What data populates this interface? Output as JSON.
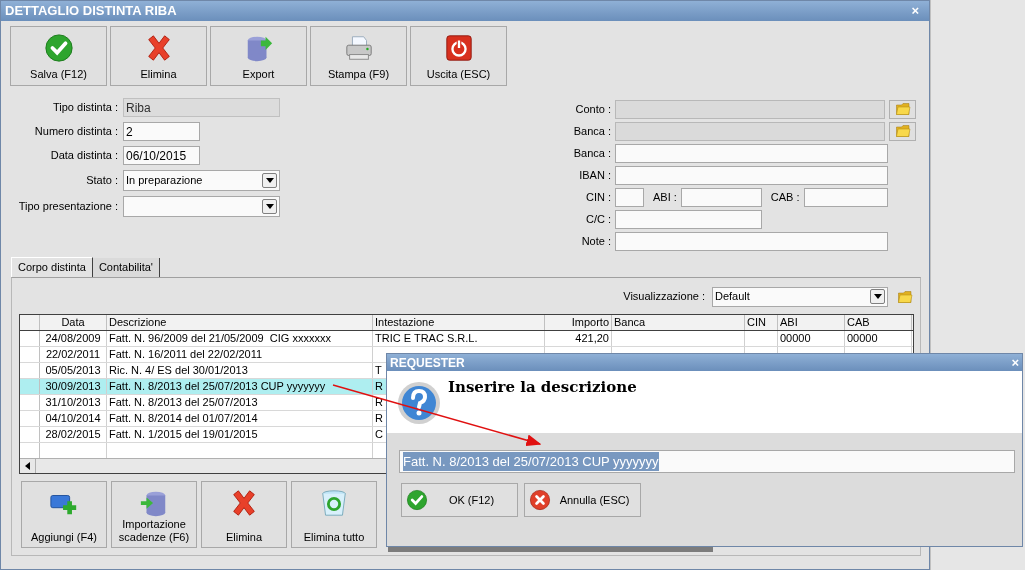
{
  "window": {
    "title": "DETTAGLIO DISTINTA RIBA",
    "close": "×"
  },
  "toolbar": [
    {
      "label": "Salva (F12)",
      "kind": "save"
    },
    {
      "label": "Elimina",
      "kind": "delete"
    },
    {
      "label": "Export",
      "kind": "export"
    },
    {
      "label": "Stampa (F9)",
      "kind": "print"
    },
    {
      "label": "Uscita (ESC)",
      "kind": "exit"
    }
  ],
  "left_form": [
    {
      "label": "Tipo distinta :",
      "value": "Riba",
      "kind": "text",
      "disabled": true
    },
    {
      "label": "Numero distinta :",
      "value": "2",
      "kind": "text",
      "disabled": false
    },
    {
      "label": "Data distinta :",
      "value": "06/10/2015",
      "kind": "text",
      "disabled": false
    },
    {
      "label": "Stato :",
      "value": "In preparazione",
      "kind": "dropdown",
      "disabled": false
    },
    {
      "label": "Tipo presentazione :",
      "kind": "dropdown",
      "disabled": false
    }
  ],
  "right_form": [
    {
      "kind": "lookup",
      "fields": [
        {
          "label": "Conto :",
          "disabled": true
        }
      ]
    },
    {
      "kind": "lookup",
      "fields": [
        {
          "label": "Banca :",
          "disabled": true
        }
      ]
    },
    {
      "kind": "full",
      "fields": [
        {
          "label": "Banca :",
          "disabled": false
        }
      ]
    },
    {
      "kind": "full",
      "fields": [
        {
          "label": "IBAN :",
          "disabled": false
        }
      ]
    },
    {
      "kind": "triple",
      "fields": [
        {
          "label": "CIN :",
          "disabled": false
        },
        {
          "label": "ABI :",
          "disabled": false
        },
        {
          "label": "CAB :",
          "disabled": false
        }
      ]
    },
    {
      "kind": "half",
      "fields": [
        {
          "label": "C/C :",
          "disabled": false
        }
      ]
    },
    {
      "kind": "full",
      "fields": [
        {
          "label": "Note :",
          "disabled": false
        }
      ]
    }
  ],
  "tabs": [
    {
      "label": "Corpo distinta",
      "selected": true
    },
    {
      "label": "Contabilita'",
      "selected": false
    }
  ],
  "view_selector": {
    "label": "Visualizzazione :",
    "value": "Default"
  },
  "table": {
    "columns": [
      "Data",
      "Descrizione",
      "Intestazione",
      "Importo",
      "Banca",
      "CIN",
      "ABI",
      "CAB"
    ],
    "rows": [
      {
        "selected": false,
        "cells": [
          "24/08/2009",
          "Fatt. N. 96/2009 del 21/05/2009  CIG xxxxxxx",
          "TRIC E TRAC S.R.L.",
          "421,20",
          null,
          null,
          "00000",
          "00000"
        ]
      },
      {
        "selected": false,
        "cells": [
          "22/02/2011",
          "Fatt. N. 16/2011 del 22/02/2011"
        ]
      },
      {
        "selected": false,
        "cells": [
          "05/05/2013",
          "Ric. N. 4/ ES del 30/01/2013",
          "T"
        ]
      },
      {
        "selected": true,
        "cells": [
          "30/09/2013",
          "Fatt. N. 8/2013 del 25/07/2013 CUP yyyyyyy",
          "R"
        ]
      },
      {
        "selected": false,
        "cells": [
          "31/10/2013",
          "Fatt. N. 8/2013 del 25/07/2013",
          "R"
        ]
      },
      {
        "selected": false,
        "cells": [
          "04/10/2014",
          "Fatt. N. 8/2014 del 01/07/2014",
          "R"
        ]
      },
      {
        "selected": false,
        "cells": [
          "28/02/2015",
          "Fatt. N. 1/2015 del 19/01/2015",
          "C"
        ]
      }
    ]
  },
  "bottom_buttons": [
    {
      "label": "Aggiungi (F4)",
      "kind": "add"
    },
    {
      "label": "Importazione scadenze (F6)",
      "kind": "import"
    },
    {
      "label": "Elimina",
      "kind": "delete"
    },
    {
      "label": "Elimina tutto",
      "kind": "bin"
    }
  ],
  "dialog": {
    "title": "REQUESTER",
    "close": "×",
    "prompt": "Inserire la descrizione",
    "value": "Fatt. N. 8/2013 del 25/07/2013 CUP yyyyyyy",
    "text_selected": true,
    "buttons": [
      {
        "label": "OK (F12)",
        "kind": "ok"
      },
      {
        "label": "Annulla (ESC)",
        "kind": "cancel"
      }
    ]
  }
}
